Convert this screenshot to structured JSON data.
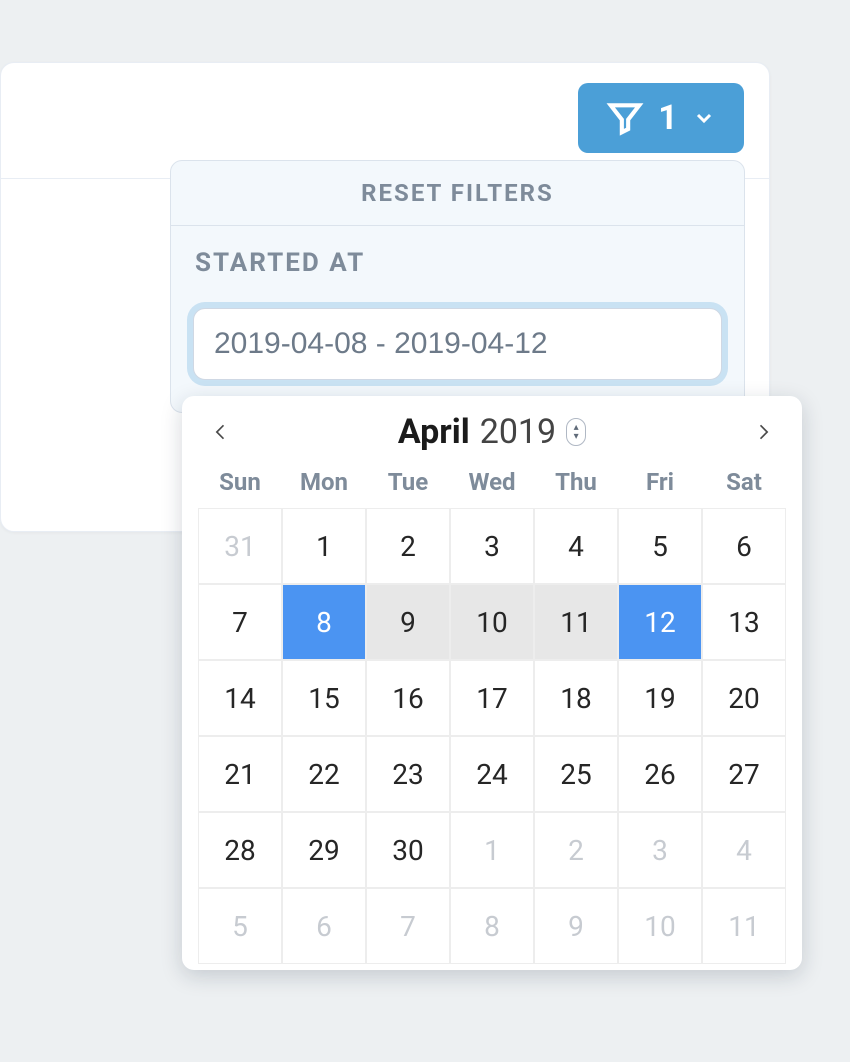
{
  "filter_button": {
    "count": "1"
  },
  "panel": {
    "reset_label": "RESET FILTERS",
    "section_label": "STARTED AT",
    "date_input_value": "2019-04-08 - 2019-04-12"
  },
  "calendar": {
    "month": "April",
    "year": "2019",
    "day_headers": [
      "Sun",
      "Mon",
      "Tue",
      "Wed",
      "Thu",
      "Fri",
      "Sat"
    ],
    "weeks": [
      [
        {
          "d": "31",
          "out": true
        },
        {
          "d": "1"
        },
        {
          "d": "2"
        },
        {
          "d": "3"
        },
        {
          "d": "4"
        },
        {
          "d": "5"
        },
        {
          "d": "6"
        }
      ],
      [
        {
          "d": "7"
        },
        {
          "d": "8",
          "endpoint": true
        },
        {
          "d": "9",
          "inrange": true
        },
        {
          "d": "10",
          "inrange": true
        },
        {
          "d": "11",
          "inrange": true
        },
        {
          "d": "12",
          "endpoint": true
        },
        {
          "d": "13"
        }
      ],
      [
        {
          "d": "14"
        },
        {
          "d": "15"
        },
        {
          "d": "16"
        },
        {
          "d": "17"
        },
        {
          "d": "18"
        },
        {
          "d": "19"
        },
        {
          "d": "20"
        }
      ],
      [
        {
          "d": "21"
        },
        {
          "d": "22"
        },
        {
          "d": "23"
        },
        {
          "d": "24"
        },
        {
          "d": "25"
        },
        {
          "d": "26"
        },
        {
          "d": "27"
        }
      ],
      [
        {
          "d": "28"
        },
        {
          "d": "29"
        },
        {
          "d": "30"
        },
        {
          "d": "1",
          "out": true
        },
        {
          "d": "2",
          "out": true
        },
        {
          "d": "3",
          "out": true
        },
        {
          "d": "4",
          "out": true
        }
      ],
      [
        {
          "d": "5",
          "out": true
        },
        {
          "d": "6",
          "out": true
        },
        {
          "d": "7",
          "out": true
        },
        {
          "d": "8",
          "out": true
        },
        {
          "d": "9",
          "out": true
        },
        {
          "d": "10",
          "out": true
        },
        {
          "d": "11",
          "out": true
        }
      ]
    ]
  }
}
